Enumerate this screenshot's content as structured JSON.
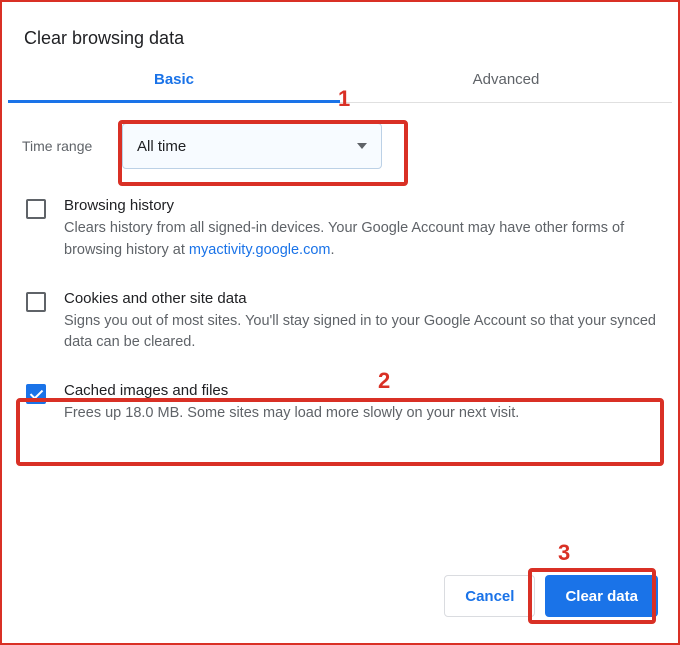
{
  "title": "Clear browsing data",
  "tabs": {
    "basic": "Basic",
    "advanced": "Advanced"
  },
  "timeRange": {
    "label": "Time range",
    "value": "All time"
  },
  "options": {
    "history": {
      "title": "Browsing history",
      "descPrefix": "Clears history from all signed-in devices. Your Google Account may have other forms of browsing history at ",
      "descLink": "myactivity.google.com",
      "descSuffix": "."
    },
    "cookies": {
      "title": "Cookies and other site data",
      "desc": "Signs you out of most sites. You'll stay signed in to your Google Account so that your synced data can be cleared."
    },
    "cache": {
      "title": "Cached images and files",
      "desc": "Frees up 18.0 MB. Some sites may load more slowly on your next visit."
    }
  },
  "buttons": {
    "cancel": "Cancel",
    "clear": "Clear data"
  },
  "annotations": {
    "n1": "1",
    "n2": "2",
    "n3": "3"
  }
}
